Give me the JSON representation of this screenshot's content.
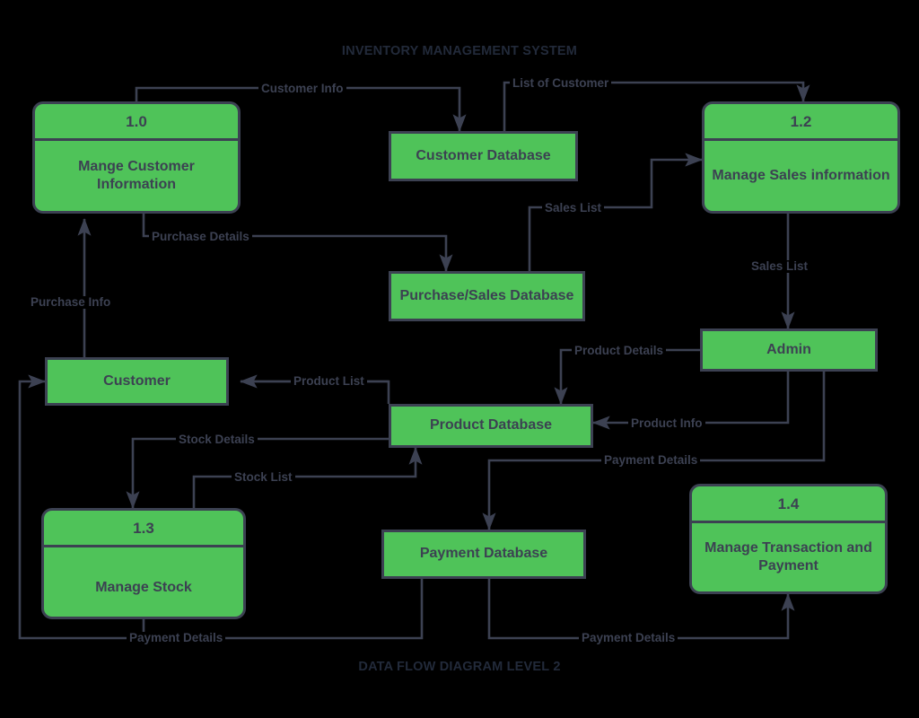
{
  "diagram": {
    "title": "INVENTORY MANAGEMENT SYSTEM",
    "footer": "DATA FLOW DIAGRAM LEVEL 2",
    "colors": {
      "node_fill": "#4FC359",
      "node_stroke": "#3C4152",
      "text": "#3C4152",
      "background": "#000000",
      "title_text": "#222A3A"
    }
  },
  "nodes": {
    "manage_customer": {
      "id": "1.0",
      "label": "Mange Customer Information",
      "type": "process"
    },
    "manage_sales": {
      "id": "1.2",
      "label": "Manage Sales information",
      "type": "process"
    },
    "manage_stock": {
      "id": "1.3",
      "label": "Manage Stock",
      "type": "process"
    },
    "manage_transaction": {
      "id": "1.4",
      "label": "Manage Transaction and Payment",
      "type": "process"
    },
    "customer_db": {
      "label": "Customer Database",
      "type": "datastore"
    },
    "purchase_sales_db": {
      "label": "Purchase/Sales Database",
      "type": "datastore"
    },
    "product_db": {
      "label": "Product Database",
      "type": "datastore"
    },
    "payment_db": {
      "label": "Payment Database",
      "type": "datastore"
    },
    "customer_entity": {
      "label": "Customer",
      "type": "entity"
    },
    "admin_entity": {
      "label": "Admin",
      "type": "entity"
    }
  },
  "flows": [
    {
      "key": "customer_info",
      "label": "Customer Info",
      "from": "manage_customer",
      "to": "customer_db"
    },
    {
      "key": "list_of_customer",
      "label": "List of Customer",
      "from": "customer_db",
      "to": "manage_sales"
    },
    {
      "key": "purchase_details",
      "label": "Purchase Details",
      "from": "manage_customer",
      "to": "purchase_sales_db"
    },
    {
      "key": "sales_list_up",
      "label": "Sales List",
      "from": "purchase_sales_db",
      "to": "manage_sales"
    },
    {
      "key": "purchase_info",
      "label": "Purchase Info",
      "from": "customer_entity",
      "to": "manage_customer"
    },
    {
      "key": "sales_list_down",
      "label": "Sales List",
      "from": "manage_sales",
      "to": "admin_entity"
    },
    {
      "key": "product_details",
      "label": "Product Details",
      "from": "admin_entity",
      "to": "product_db"
    },
    {
      "key": "product_info",
      "label": "Product Info",
      "from": "admin_entity",
      "to": "product_db"
    },
    {
      "key": "product_list",
      "label": "Product List",
      "from": "product_db",
      "to": "customer_entity"
    },
    {
      "key": "stock_details",
      "label": "Stock Details",
      "from": "product_db",
      "to": "manage_stock"
    },
    {
      "key": "stock_list",
      "label": "Stock List",
      "from": "manage_stock",
      "to": "product_db"
    },
    {
      "key": "payment_details_admin",
      "label": "Payment Details",
      "from": "admin_entity",
      "to": "payment_db"
    },
    {
      "key": "payment_details_left",
      "label": "Payment Details",
      "from": "payment_db",
      "to": "customer_entity"
    },
    {
      "key": "payment_details_right",
      "label": "Payment Details",
      "from": "payment_db",
      "to": "manage_transaction"
    }
  ]
}
